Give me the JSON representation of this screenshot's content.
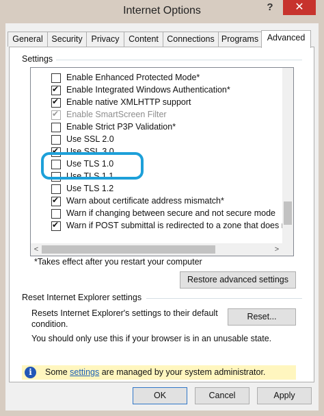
{
  "window": {
    "title": "Internet Options",
    "help_symbol": "?",
    "close_symbol": "✕"
  },
  "tabs": [
    {
      "label": "General"
    },
    {
      "label": "Security"
    },
    {
      "label": "Privacy"
    },
    {
      "label": "Content"
    },
    {
      "label": "Connections"
    },
    {
      "label": "Programs"
    },
    {
      "label": "Advanced",
      "selected": true
    }
  ],
  "settings": {
    "label": "Settings",
    "items": [
      {
        "label": "Enable Enhanced Protected Mode*",
        "checked": false
      },
      {
        "label": "Enable Integrated Windows Authentication*",
        "checked": true
      },
      {
        "label": "Enable native XMLHTTP support",
        "checked": true
      },
      {
        "label": "Enable SmartScreen Filter",
        "checked": true,
        "disabled": true
      },
      {
        "label": "Enable Strict P3P Validation*",
        "checked": false
      },
      {
        "label": "Use SSL 2.0",
        "checked": false
      },
      {
        "label": "Use SSL 3.0",
        "checked": true
      },
      {
        "label": "Use TLS 1.0",
        "checked": false
      },
      {
        "label": "Use TLS 1.1",
        "checked": false
      },
      {
        "label": "Use TLS 1.2",
        "checked": false
      },
      {
        "label": "Warn about certificate address mismatch*",
        "checked": true
      },
      {
        "label": "Warn if changing between secure and not secure mode",
        "checked": false
      },
      {
        "label": "Warn if POST submittal is redirected to a zone that does n",
        "checked": true
      }
    ],
    "highlight_color": "#1da0d9",
    "footnote": "*Takes effect after you restart your computer",
    "restore_label": "Restore advanced settings",
    "scroll_left": "<",
    "scroll_right": ">"
  },
  "reset": {
    "label": "Reset Internet Explorer settings",
    "description": "Resets Internet Explorer's settings to their default condition.",
    "button_label": "Reset...",
    "note": "You should only use this if your browser is in an unusable state."
  },
  "infobar": {
    "icon": "info-icon",
    "prefix": "Some ",
    "link": "settings",
    "suffix": " are managed by your system administrator.",
    "background": "#fff6bf"
  },
  "buttons": {
    "ok": "OK",
    "cancel": "Cancel",
    "apply": "Apply"
  }
}
